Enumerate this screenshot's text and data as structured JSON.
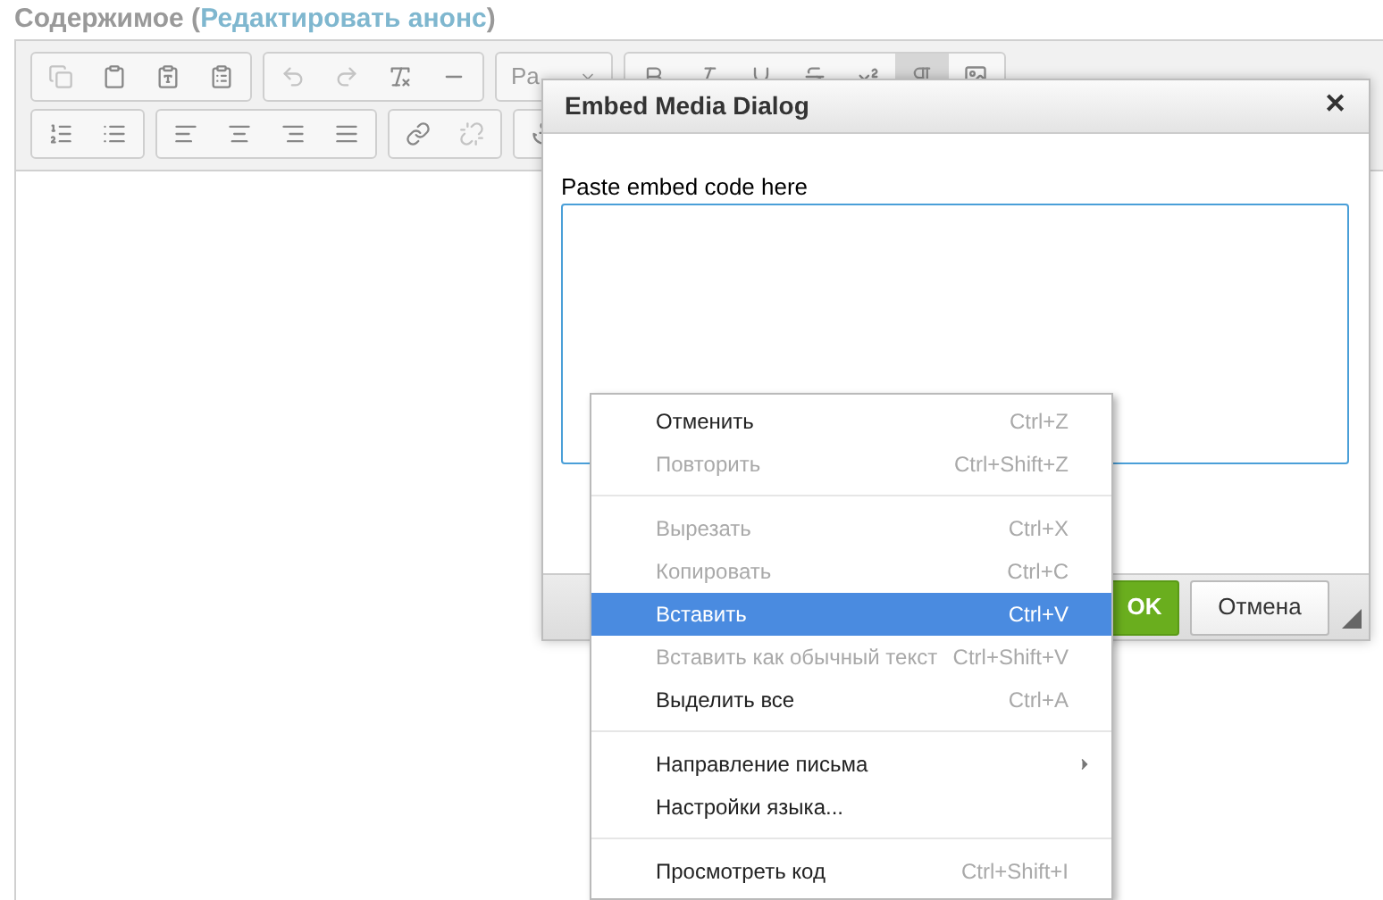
{
  "heading": {
    "title": "Содержимое (",
    "link": "Редактировать анонс",
    "suffix": ")"
  },
  "toolbar": {
    "row1": [
      [
        {
          "active": false
        },
        {
          "active": false
        },
        {
          "active": false
        },
        {
          "active": false
        }
      ],
      [
        {
          "active": false
        },
        {
          "active": false
        },
        {
          "active": false
        },
        {
          "active": false
        }
      ]
    ],
    "format_value": "Pa",
    "row1_styles": [
      {
        "active": false
      },
      {
        "active": false
      },
      {
        "active": false
      },
      {
        "active": false
      },
      {
        "active": false
      },
      {
        "active": true
      },
      {
        "active": false
      }
    ],
    "row2": [
      [
        {
          "active": false
        },
        {
          "active": false
        }
      ],
      [
        {
          "active": false
        },
        {
          "active": false
        },
        {
          "active": false
        },
        {
          "active": false
        }
      ],
      [
        {
          "active": false
        },
        {
          "active": false
        }
      ],
      [
        {
          "active": false
        }
      ]
    ]
  },
  "dialog": {
    "title": "Embed Media Dialog",
    "close": "✕",
    "label": "Paste embed code here",
    "buttons": [
      {
        "label": "OK",
        "kind": "primary"
      },
      {
        "label": "Отмена",
        "kind": "secondary"
      }
    ]
  },
  "context_menu": {
    "groups": [
      [
        {
          "label": "Отменить",
          "shortcut": "Ctrl+Z",
          "disabled": false,
          "selected": false,
          "submenu": false
        },
        {
          "label": "Повторить",
          "shortcut": "Ctrl+Shift+Z",
          "disabled": true,
          "selected": false,
          "submenu": false
        }
      ],
      [
        {
          "label": "Вырезать",
          "shortcut": "Ctrl+X",
          "disabled": true,
          "selected": false,
          "submenu": false
        },
        {
          "label": "Копировать",
          "shortcut": "Ctrl+C",
          "disabled": true,
          "selected": false,
          "submenu": false
        },
        {
          "label": "Вставить",
          "shortcut": "Ctrl+V",
          "disabled": false,
          "selected": true,
          "submenu": false
        },
        {
          "label": "Вставить как обычный текст",
          "shortcut": "Ctrl+Shift+V",
          "disabled": true,
          "selected": false,
          "submenu": false
        },
        {
          "label": "Выделить все",
          "shortcut": "Ctrl+A",
          "disabled": false,
          "selected": false,
          "submenu": false
        }
      ],
      [
        {
          "label": "Направление письма",
          "disabled": false,
          "selected": false,
          "submenu": true
        },
        {
          "label": "Настройки языка...",
          "disabled": false,
          "selected": false,
          "submenu": false
        }
      ],
      [
        {
          "label": "Просмотреть код",
          "shortcut": "Ctrl+Shift+I",
          "disabled": false,
          "selected": false,
          "submenu": false
        }
      ]
    ]
  }
}
